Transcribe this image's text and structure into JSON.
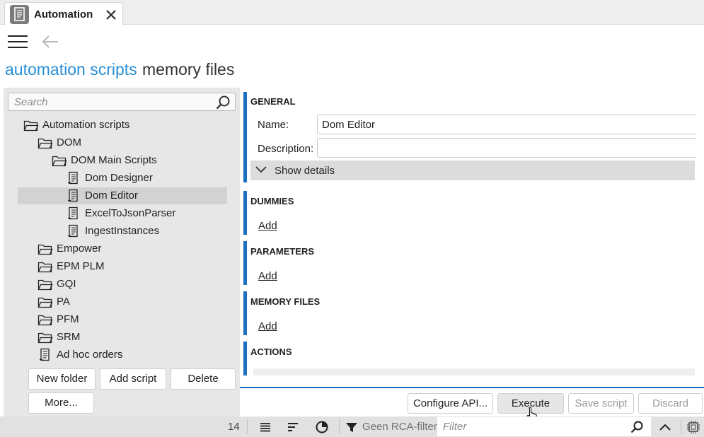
{
  "tab": {
    "title": "Automation"
  },
  "page_tabs": {
    "active": "automation scripts",
    "inactive": "memory files"
  },
  "search": {
    "placeholder": "Search"
  },
  "tree": [
    {
      "label": "Automation scripts",
      "type": "folder",
      "level": 0
    },
    {
      "label": "DOM",
      "type": "folder",
      "level": 1
    },
    {
      "label": "DOM Main Scripts",
      "type": "folder",
      "level": 2
    },
    {
      "label": "Dom Designer",
      "type": "script",
      "level": 3
    },
    {
      "label": "Dom Editor",
      "type": "script",
      "level": 3,
      "selected": true
    },
    {
      "label": "ExcelToJsonParser",
      "type": "script",
      "level": 3
    },
    {
      "label": "IngestInstances",
      "type": "script",
      "level": 3
    },
    {
      "label": "Empower",
      "type": "folder",
      "level": 1
    },
    {
      "label": "EPM PLM",
      "type": "folder",
      "level": 1
    },
    {
      "label": "GQI",
      "type": "folder",
      "level": 1
    },
    {
      "label": "PA",
      "type": "folder",
      "level": 1
    },
    {
      "label": "PFM",
      "type": "folder",
      "level": 1
    },
    {
      "label": "SRM",
      "type": "folder",
      "level": 1
    },
    {
      "label": "Ad hoc orders",
      "type": "script",
      "level": 1
    }
  ],
  "left_buttons": {
    "new_folder": "New folder",
    "add_script": "Add script",
    "delete": "Delete",
    "more": "More..."
  },
  "general": {
    "title": "GENERAL",
    "name_label": "Name:",
    "name_value": "Dom Editor",
    "description_label": "Description:",
    "description_value": "",
    "show_details": "Show details"
  },
  "sections": {
    "dummies": "DUMMIES",
    "parameters": "PARAMETERS",
    "memory_files": "MEMORY FILES",
    "actions": "ACTIONS",
    "add_label": "Add"
  },
  "action_buttons": {
    "configure_api": "Configure API...",
    "execute": "Execute",
    "save_script": "Save script",
    "discard": "Discard"
  },
  "statusbar": {
    "count": "14",
    "filter_status": "Geen RCA-filter",
    "filter_placeholder": "Filter"
  },
  "colors": {
    "accent": "#2a8fd6",
    "section_bar": "#1e6fbf",
    "panel_bg": "#e7e7e7",
    "selected_bg": "#d2d2d2"
  }
}
